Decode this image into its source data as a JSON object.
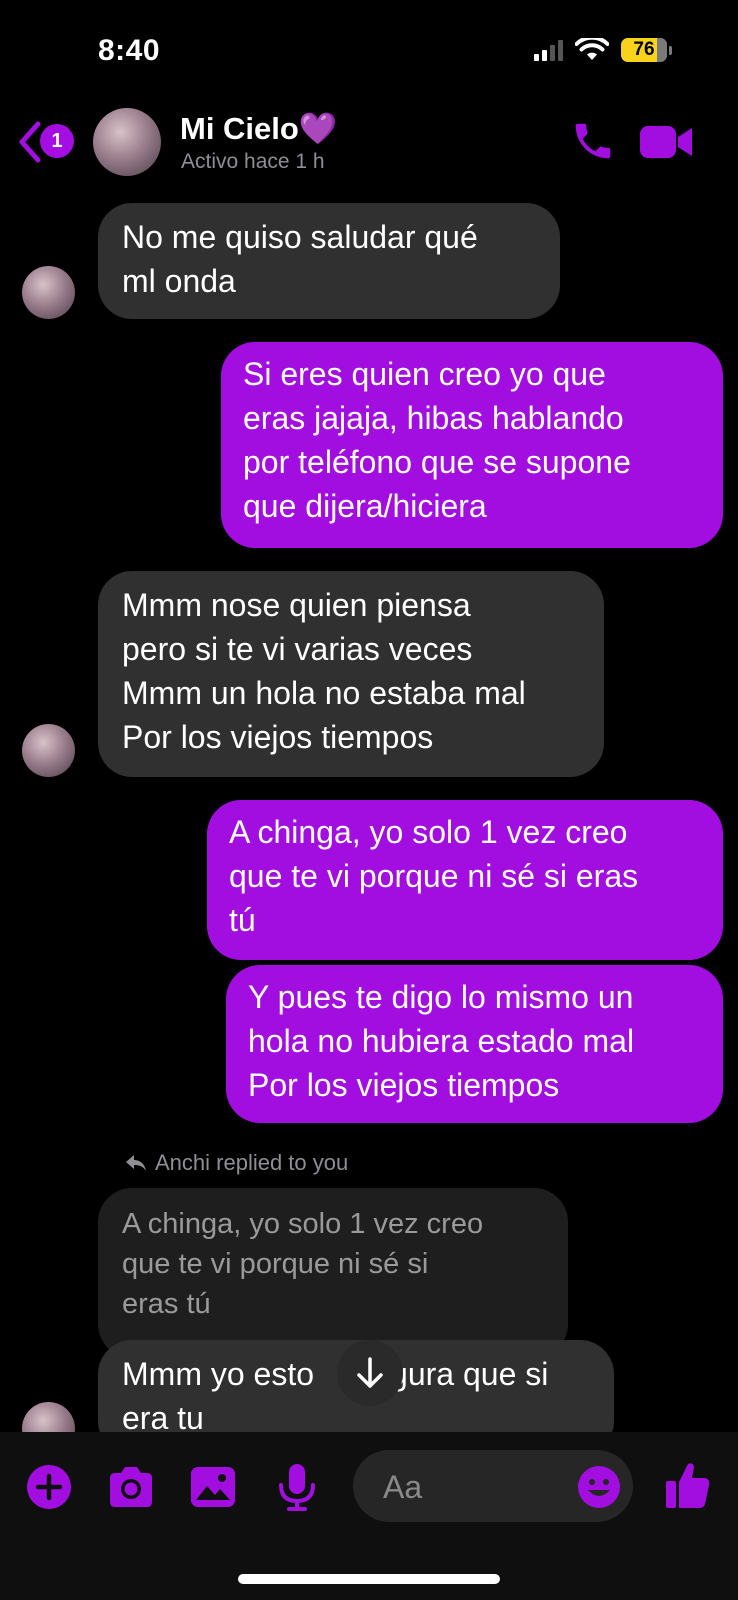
{
  "status_bar": {
    "time": "8:40",
    "battery": "76"
  },
  "header": {
    "back_badge": "1",
    "contact_name": "Mi Cielo💜",
    "contact_status": "Activo hace 1 h"
  },
  "messages": [
    {
      "direction": "incoming",
      "lines": [
        "No me quiso saludar qué",
        "ml onda"
      ]
    },
    {
      "direction": "outgoing",
      "lines": [
        "Si eres quien creo yo que",
        "eras jajaja, hibas hablando",
        "por teléfono que se supone",
        "que dijera/hiciera"
      ]
    },
    {
      "direction": "incoming",
      "lines": [
        "Mmm nose quien piensa",
        "pero si te vi varias veces",
        "Mmm un hola no estaba mal",
        "Por los viejos tiempos"
      ]
    },
    {
      "direction": "outgoing",
      "lines": [
        "A chinga, yo solo 1 vez creo",
        "que te vi porque ni sé si eras",
        "tú"
      ]
    },
    {
      "direction": "outgoing",
      "lines": [
        "Y pues te digo lo mismo un",
        "hola no hubiera estado mal",
        "Por los viejos tiempos"
      ]
    }
  ],
  "reply": {
    "label": "Anchi replied to you",
    "quoted_lines": [
      "A chinga, yo solo 1 vez creo",
      "que te vi porque ni sé si",
      "eras tú"
    ],
    "message_line1_a": "Mmm yo esto",
    "message_line1_b": "gura que si",
    "message_line2": "era tu"
  },
  "composer": {
    "placeholder": "Aa"
  },
  "icons": [
    "back-icon",
    "phone-icon",
    "video-camera-icon",
    "scroll-down-arrow-icon",
    "plus-icon",
    "camera-icon",
    "gallery-icon",
    "microphone-icon",
    "emoji-icon",
    "thumbs-up-icon"
  ],
  "colors": {
    "accent": "#a30ee0",
    "incoming_bubble": "#303030",
    "background": "#000000"
  }
}
